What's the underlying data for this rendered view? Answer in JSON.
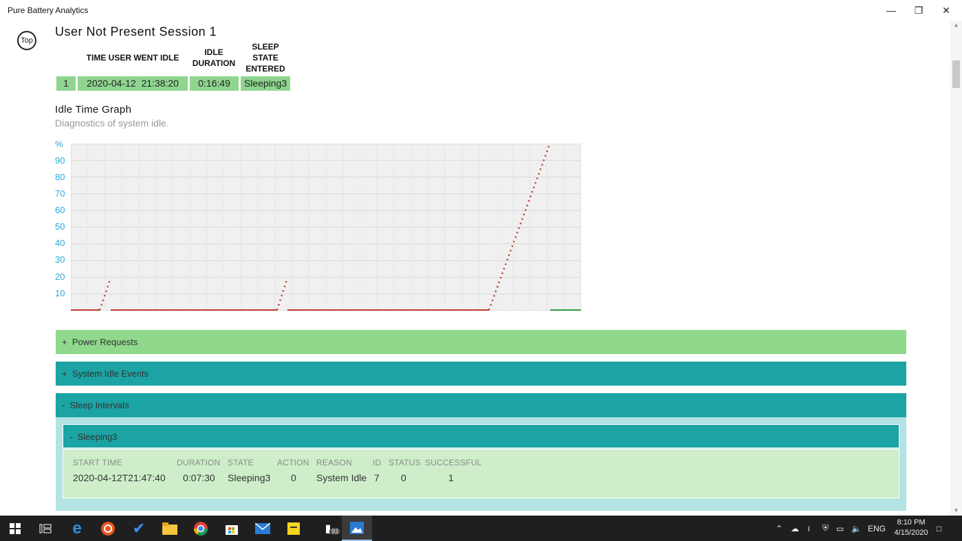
{
  "window": {
    "title": "Pure Battery Analytics",
    "minimize": "—",
    "restore": "❐",
    "close": "✕"
  },
  "top_button": "Top",
  "session": {
    "title": "User Not Present Session 1",
    "headers": [
      "TIME USER WENT IDLE",
      "IDLE DURATION",
      "SLEEP STATE ENTERED"
    ],
    "row": {
      "index": "1",
      "time": "2020-04-12  21:38:20",
      "duration": "0:16:49",
      "state": "Sleeping3"
    }
  },
  "graph": {
    "title": "Idle Time Graph",
    "subtitle": "Diagnostics of system idle.",
    "y_unit": "%",
    "y_ticks": [
      "90",
      "80",
      "70",
      "60",
      "50",
      "40",
      "30",
      "20",
      "10"
    ]
  },
  "chart_data": {
    "type": "line",
    "ylabel": "%",
    "ylim": [
      0,
      100
    ],
    "grid": true,
    "series": [
      {
        "values": [
          0,
          0,
          18,
          0,
          0,
          0,
          18,
          0,
          0,
          0,
          0,
          100
        ]
      }
    ]
  },
  "sections": {
    "power_requests": {
      "toggle": "+",
      "label": "Power Requests"
    },
    "system_idle": {
      "toggle": "+",
      "label": "System Idle Events"
    },
    "sleep_intervals": {
      "toggle": "-",
      "label": "Sleep Intervals"
    },
    "sleeping3": {
      "toggle": "-",
      "label": "Sleeping3"
    }
  },
  "sleep_table": {
    "headers": [
      "START TIME",
      "DURATION",
      "STATE",
      "ACTION",
      "REASON",
      "ID",
      "STATUS",
      "SUCCESSFUL"
    ],
    "row": [
      "2020-04-12T21:47:40",
      "0:07:30",
      "Sleeping3",
      "0",
      "System Idle",
      "7",
      "0",
      "1"
    ]
  },
  "taskbar": {
    "badge": "93",
    "tray_lang": "ENG",
    "time": "8:10 PM",
    "date": "4/15/2020"
  },
  "colors": {
    "green_section": "#8fd88c",
    "teal_section": "#1ca3a3",
    "axis_label": "#2aa9d8",
    "line_red": "#c0392b",
    "line_green": "#2e9e4a"
  }
}
